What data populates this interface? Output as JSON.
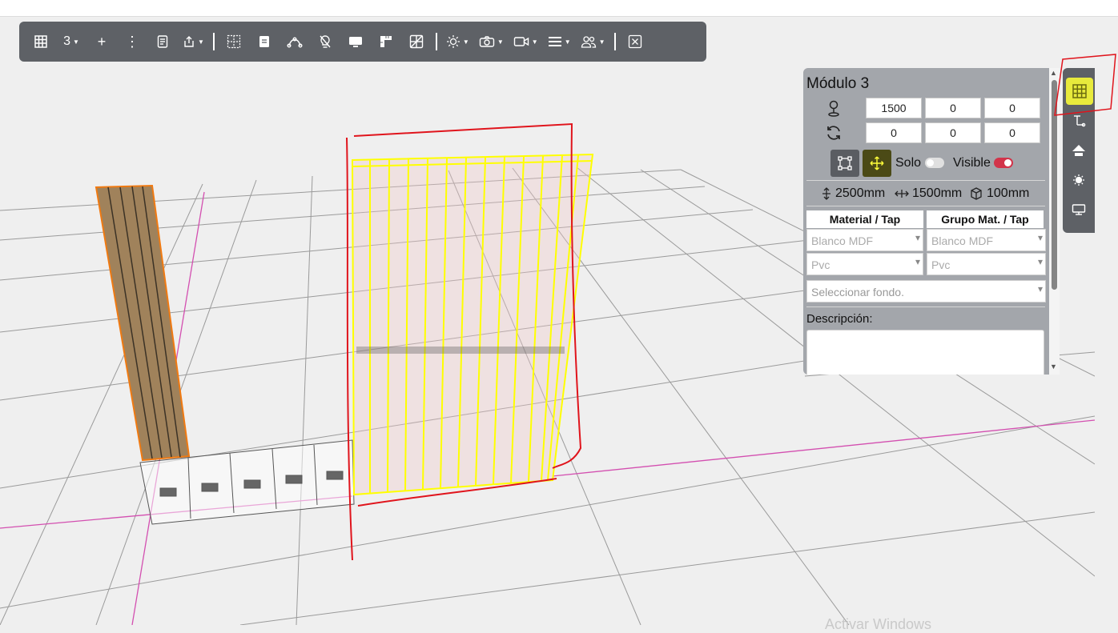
{
  "toolbar": {
    "module_count": "3",
    "items": [
      "modules-icon",
      "count-dropdown",
      "add-icon",
      "more-icon",
      "document-icon",
      "export-icon",
      "grid-icon",
      "sheet-icon",
      "curve-icon",
      "light-off-icon",
      "monitor-icon",
      "ruler-icon",
      "pattern-icon",
      "sun-icon",
      "camera-icon",
      "video-icon",
      "lines-icon",
      "users-icon",
      "close-view-icon"
    ]
  },
  "panel": {
    "title": "Módulo 3",
    "position": {
      "x": "1500",
      "y": "0",
      "z": "0"
    },
    "rotation": {
      "x": "0",
      "y": "0",
      "z": "0"
    },
    "solo_label": "Solo",
    "visible_label": "Visible",
    "solo_on": false,
    "visible_on": true,
    "height": "2500mm",
    "width": "1500mm",
    "depth": "100mm",
    "material_header": "Material / Tap",
    "group_header": "Grupo Mat. / Tap",
    "material_value": "Blanco MDF",
    "material_edge": "Pvc",
    "group_value": "Blanco MDF",
    "group_edge": "Pvc",
    "background_placeholder": "Seleccionar fondo.",
    "description_label": "Descripción:",
    "description_value": ""
  },
  "watermark": "Activar Windows",
  "colors": {
    "toolbar": "#5e6166",
    "panel": "#a3a6ab",
    "highlight": "#e8ea3c",
    "annotation": "#e0141c"
  }
}
